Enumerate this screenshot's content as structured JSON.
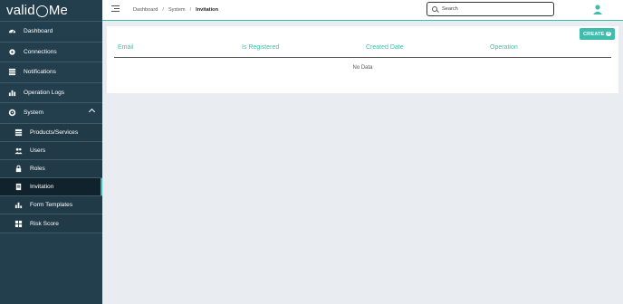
{
  "app": {
    "logo_left": "valid",
    "logo_right": "Me"
  },
  "sidebar": {
    "items": [
      {
        "label": "Dashboard",
        "icon": "gauge-icon"
      },
      {
        "label": "Connections",
        "icon": "cog-icon"
      },
      {
        "label": "Notifications",
        "icon": "list-icon"
      },
      {
        "label": "Operation Logs",
        "icon": "bar-chart-icon"
      },
      {
        "label": "System",
        "icon": "gear-icon"
      }
    ],
    "sub_items": [
      {
        "label": "Products/Services",
        "icon": "table-icon"
      },
      {
        "label": "Users",
        "icon": "users-icon"
      },
      {
        "label": "Roles",
        "icon": "lock-icon"
      },
      {
        "label": "Invitation",
        "icon": "invitation-icon"
      },
      {
        "label": "Form Templates",
        "icon": "chart-icon"
      },
      {
        "label": "Risk Score",
        "icon": "grid-icon"
      }
    ]
  },
  "breadcrumb": {
    "items": [
      "Dashboard",
      "System"
    ],
    "separator": "/",
    "current": "Invitation"
  },
  "search": {
    "placeholder": "Search"
  },
  "table": {
    "create_label": "CREATE",
    "columns": [
      "Email",
      "Is Registered",
      "Created Date",
      "Operation"
    ],
    "empty_text": "No Data"
  },
  "colors": {
    "accent": "#3fbcad",
    "sidebar": "#233e4c",
    "active": "#10232d"
  }
}
